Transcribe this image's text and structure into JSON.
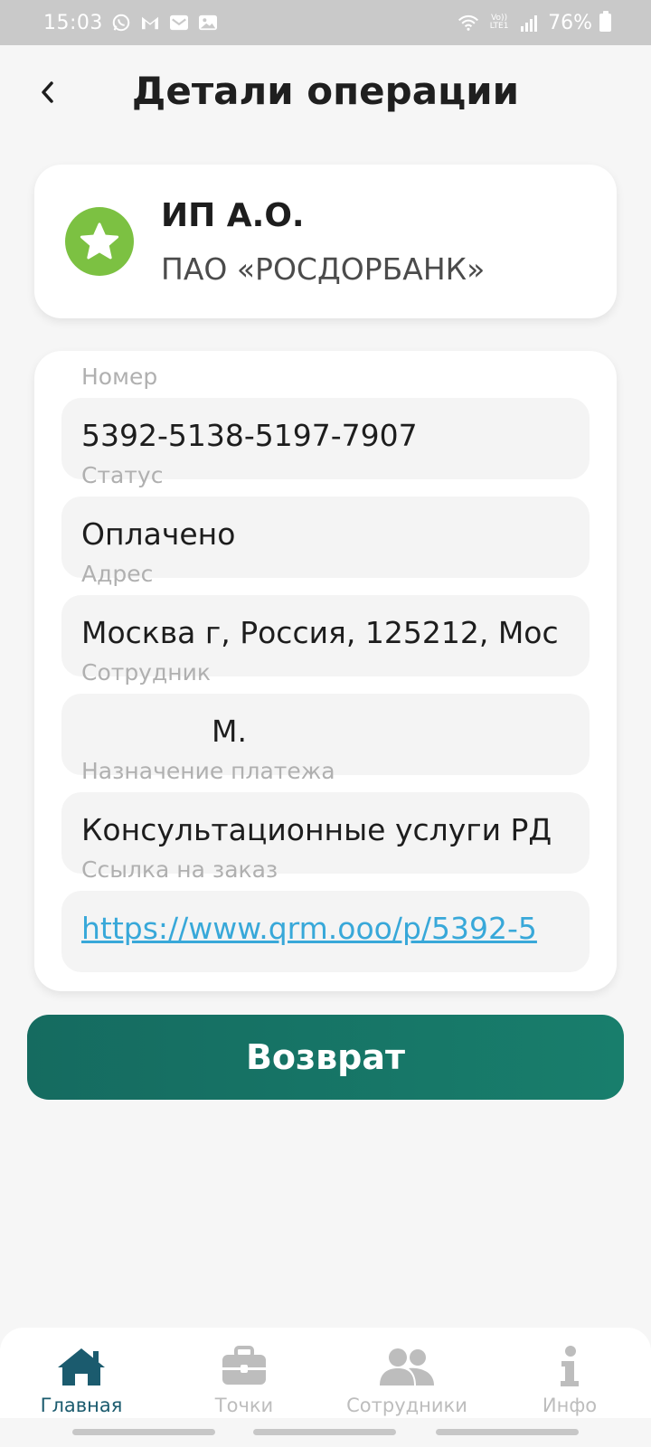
{
  "status_bar": {
    "time": "15:03",
    "lte": "Vo)) LTE1",
    "battery": "76%"
  },
  "header": {
    "title": "Детали операции"
  },
  "merchant": {
    "name": "ИП А.О.",
    "bank": "ПАО «РОСДОРБАНК»",
    "icon": "star-icon",
    "icon_color": "#7cc142"
  },
  "fields": [
    {
      "label": "Номер",
      "value": "5392-5138-5197-7907"
    },
    {
      "label": "Статус",
      "value": "Оплачено"
    },
    {
      "label": "Адрес",
      "value": "Москва г, Россия, 125212, Мос"
    },
    {
      "label": "Сотрудник",
      "value": "М."
    },
    {
      "label": "Назначение платежа",
      "value": "Консультационные услуги РД"
    },
    {
      "label": "Ссылка на заказ",
      "value": "https://www.qrm.ooo/p/5392-5"
    }
  ],
  "refund_button": {
    "label": "Возврат",
    "color": "#187e6c"
  },
  "bottom_nav": {
    "items": [
      {
        "label": "Главная",
        "icon": "home-icon",
        "active": true
      },
      {
        "label": "Точки",
        "icon": "briefcase-icon",
        "active": false
      },
      {
        "label": "Сотрудники",
        "icon": "users-icon",
        "active": false
      },
      {
        "label": "Инфо",
        "icon": "info-icon",
        "active": false
      }
    ],
    "active_color": "#1b5b6e",
    "inactive_color": "#bdbdbd"
  }
}
